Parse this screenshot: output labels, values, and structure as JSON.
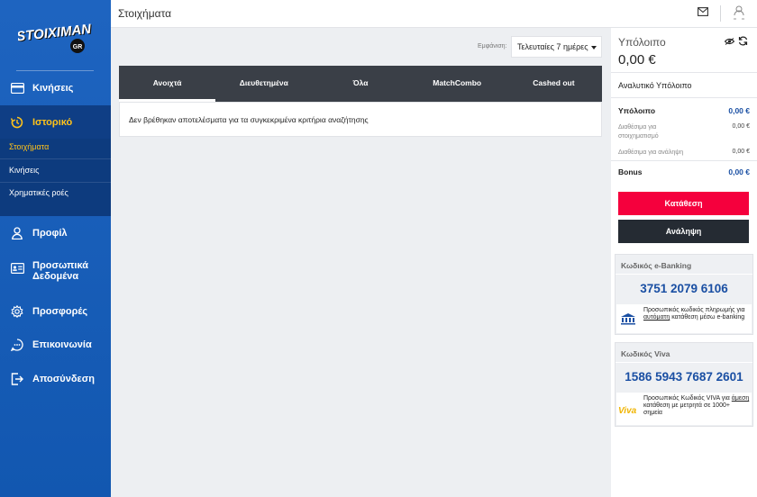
{
  "brand": {
    "logo_text": "STOIXIMAN",
    "logo_sub": "GR",
    "color": "#1e64c0"
  },
  "header": {
    "title": "Στοιχήματα",
    "mail_icon": "mail-icon",
    "user_icon": "user-icon"
  },
  "sidebar": {
    "items": [
      {
        "label": "Κινήσεις",
        "icon": "credit-card-icon"
      },
      {
        "label": "Ιστορικό",
        "icon": "history-icon",
        "active": true
      },
      {
        "label": "Προφίλ",
        "icon": "user-icon"
      },
      {
        "label": "Προσωπικά Δεδομένα",
        "line1": "Προσωπικά",
        "line2": "Δεδομένα",
        "icon": "id-card-icon"
      },
      {
        "label": "Προσφορές",
        "icon": "gear-icon"
      },
      {
        "label": "Επικοινωνία",
        "icon": "chat-icon"
      },
      {
        "label": "Αποσύνδεση",
        "icon": "logout-icon"
      }
    ],
    "subitems": [
      {
        "label": "Στοιχήματα",
        "active": true
      },
      {
        "label": "Κινήσεις"
      },
      {
        "label": "Χρηματικές ροές"
      }
    ]
  },
  "filter": {
    "label": "Εμφάνιση:",
    "value": "Τελευταίες 7 ημέρες"
  },
  "tabs": [
    {
      "label": "Ανοιχτά",
      "active": true
    },
    {
      "label": "Διευθετημένα"
    },
    {
      "label": "Όλα"
    },
    {
      "label": "MatchCombo"
    },
    {
      "label": "Cashed out"
    }
  ],
  "results": {
    "empty_message": "Δεν βρέθηκαν αποτελέσματα για τα συγκεκριμένα κριτήρια αναζήτησης"
  },
  "balance": {
    "title": "Υπόλοιπο",
    "amount": "0,00 €",
    "detail_title": "Αναλυτικό Υπόλοιπο",
    "rows": {
      "balance_label": "Υπόλοιπο",
      "balance_value": "0,00 €",
      "bet_label_1": "Διαθέσιμα για",
      "bet_label_2": "στοιχηματισμό",
      "bet_value": "0,00 €",
      "withdraw_label": "Διαθέσιμα για ανάληψη",
      "withdraw_value": "0,00 €",
      "bonus_label": "Bonus",
      "bonus_value": "0,00 €"
    },
    "deposit_button": "Κατάθεση",
    "withdraw_button": "Ανάληψη"
  },
  "ebanking": {
    "title": "Κωδικός e-Banking",
    "code": "3751 2079 6106",
    "info_a": "Προσωπικός κωδικός πληρωμής για ",
    "info_u": "αυτόματη",
    "info_b": " κατάθεση μέσω e-banking"
  },
  "viva": {
    "title": "Κωδικός Viva",
    "code": "1586 5943 7687 2601",
    "logo_text": "Viva",
    "info_a": "Προσωπικός Κωδικός VIVA για ",
    "info_u": "άμεση",
    "info_b": " κατάθεση με μετρητά σε 1000+ σημεία"
  },
  "colors": {
    "accent_yellow": "#ffc21a",
    "deposit_red": "#f5003d",
    "dark": "#252b33",
    "blue_value": "#1a4fa3"
  }
}
